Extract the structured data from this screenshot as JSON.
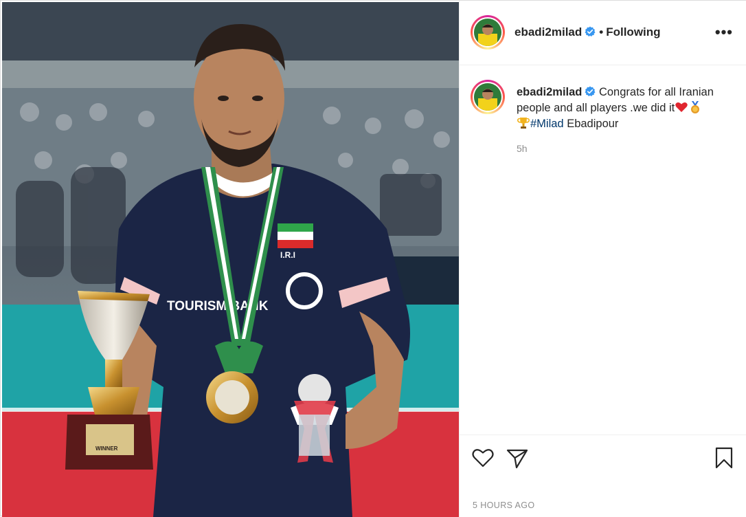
{
  "post": {
    "username": "ebadi2milad",
    "follow_status": "Following",
    "separator": "•",
    "more_label": "•••",
    "caption_text": "Congrats for all Iranian people and all players .we did it",
    "hashtag": "#Milad",
    "caption_tail": " Ebadipour",
    "comment_time": "5h",
    "posted_time": "5 HOURS AGO"
  },
  "photo": {
    "jersey_flag_text": "I.R.I",
    "jersey_sponsor": "TOURISM BANK",
    "trophy_plate": "WINNER"
  },
  "colors": {
    "verified": "#3897f0",
    "hashtag": "#00376b",
    "muted": "#8e8e8e",
    "jersey": "#1b2545",
    "court_teal": "#1fa3a6",
    "court_red": "#d8323e"
  },
  "icons": {
    "verified": "verified-badge-icon",
    "heart": "heart-icon",
    "share": "paper-plane-icon",
    "save": "bookmark-icon",
    "more": "more-options-icon",
    "trophy": "trophy-emoji",
    "medal": "medal-emoji",
    "red_heart": "red-heart-emoji"
  }
}
